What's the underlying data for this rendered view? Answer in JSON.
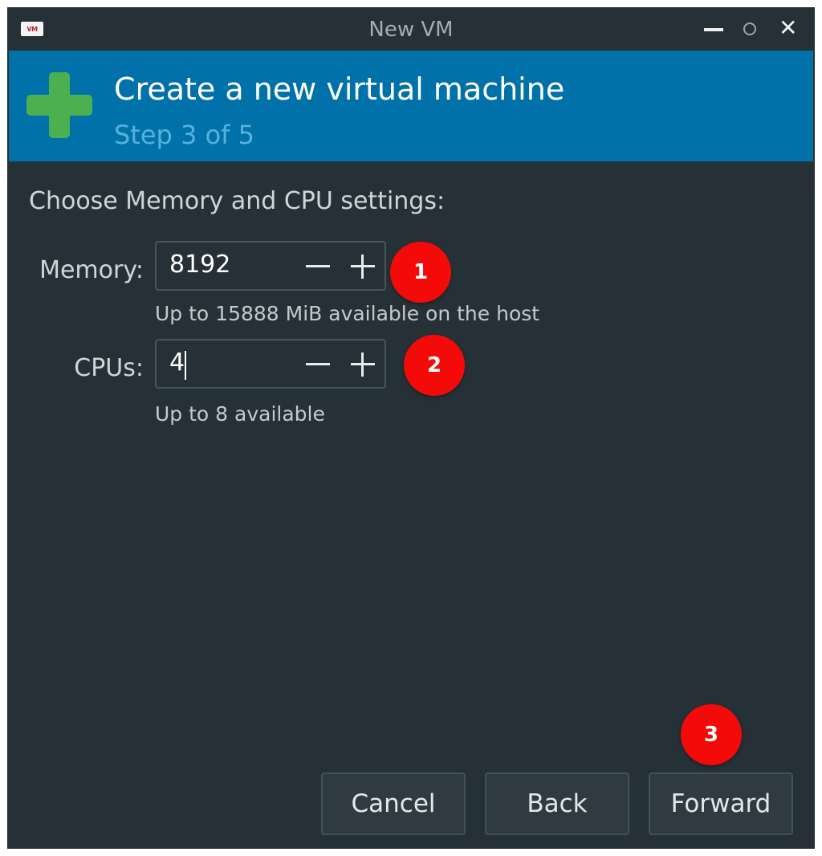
{
  "window": {
    "app_icon_text": "VM",
    "title": "New VM"
  },
  "banner": {
    "title": "Create a new virtual machine",
    "step": "Step 3 of 5",
    "icon": "plus-icon",
    "icon_color": "#4caf50"
  },
  "content": {
    "heading": "Choose Memory and CPU settings:",
    "memory": {
      "label": "Memory:",
      "value": "8192",
      "hint": "Up to 15888 MiB available on the host"
    },
    "cpus": {
      "label": "CPUs:",
      "value": "4",
      "hint": "Up to 8 available"
    }
  },
  "annotations": [
    "1",
    "2",
    "3"
  ],
  "buttons": {
    "cancel": "Cancel",
    "back": "Back",
    "forward": "Forward"
  },
  "colors": {
    "background": "#263137",
    "banner": "#0071a9",
    "badge": "#f50a0a"
  }
}
